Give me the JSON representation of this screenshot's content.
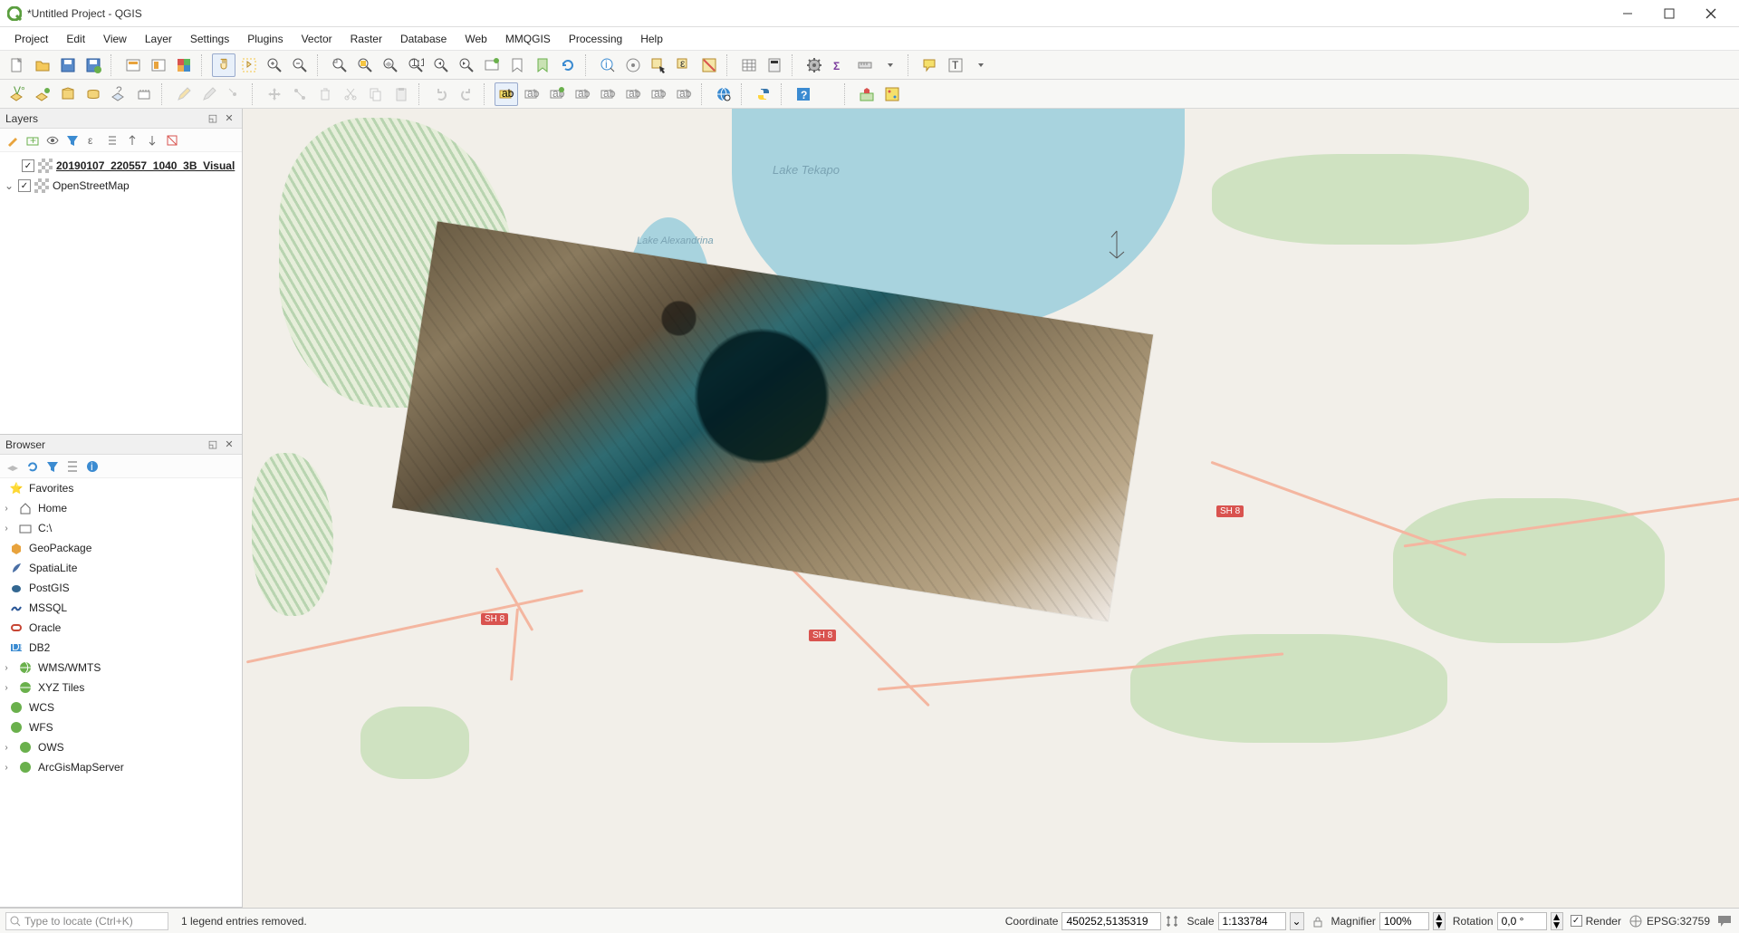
{
  "window": {
    "title": "*Untitled Project - QGIS"
  },
  "menus": [
    "Project",
    "Edit",
    "View",
    "Layer",
    "Settings",
    "Plugins",
    "Vector",
    "Raster",
    "Database",
    "Web",
    "MMQGIS",
    "Processing",
    "Help"
  ],
  "panels": {
    "layers": {
      "title": "Layers",
      "items": [
        {
          "name": "20190107_220557_1040_3B_Visual",
          "checked": true,
          "active": true
        },
        {
          "name": "OpenStreetMap",
          "checked": true,
          "active": false,
          "expandable": true
        }
      ]
    },
    "browser": {
      "title": "Browser",
      "items": [
        {
          "name": "Favorites",
          "icon": "star",
          "color": "#f5c542"
        },
        {
          "name": "Home",
          "icon": "home",
          "expandable": true
        },
        {
          "name": "C:\\",
          "icon": "folder",
          "expandable": true
        },
        {
          "name": "GeoPackage",
          "icon": "box",
          "color": "#e8a33d"
        },
        {
          "name": "SpatiaLite",
          "icon": "feather",
          "color": "#4a6fa5"
        },
        {
          "name": "PostGIS",
          "icon": "elephant",
          "color": "#336791"
        },
        {
          "name": "MSSQL",
          "icon": "wave",
          "color": "#2b5797"
        },
        {
          "name": "Oracle",
          "icon": "pill",
          "color": "#c74634"
        },
        {
          "name": "DB2",
          "icon": "db2",
          "color": "#3b8bd1"
        },
        {
          "name": "WMS/WMTS",
          "icon": "globe",
          "expandable": true
        },
        {
          "name": "XYZ Tiles",
          "icon": "globe",
          "expandable": true
        },
        {
          "name": "WCS",
          "icon": "globe"
        },
        {
          "name": "WFS",
          "icon": "globe"
        },
        {
          "name": "OWS",
          "icon": "globe",
          "expandable": true
        },
        {
          "name": "ArcGisMapServer",
          "icon": "globe",
          "expandable": true
        }
      ]
    }
  },
  "map": {
    "lake_labels": [
      "Lake Tekapo",
      "Lake Alexandrina"
    ],
    "road_labels": [
      "SH 8",
      "SH 8",
      "SH 8"
    ]
  },
  "statusbar": {
    "locate_placeholder": "Type to locate (Ctrl+K)",
    "message": "1 legend entries removed.",
    "coordinate_label": "Coordinate",
    "coordinate_value": "450252,5135319",
    "scale_label": "Scale",
    "scale_value": "1:133784",
    "magnifier_label": "Magnifier",
    "magnifier_value": "100%",
    "rotation_label": "Rotation",
    "rotation_value": "0,0 °",
    "render_label": "Render",
    "crs_label": "EPSG:32759"
  }
}
